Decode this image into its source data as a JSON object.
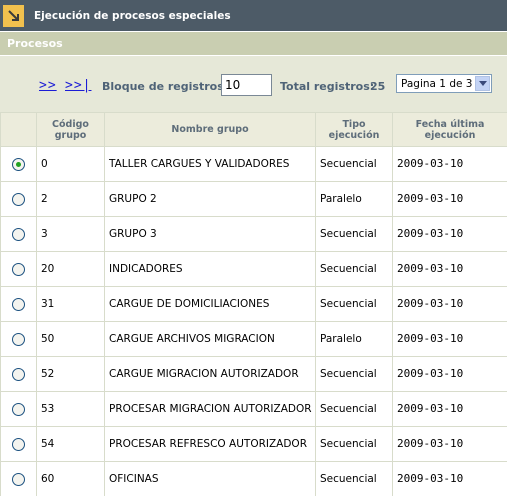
{
  "window": {
    "title": "Ejecución de procesos especiales",
    "icon": "arrow-down-right-icon"
  },
  "section": {
    "title": "Procesos"
  },
  "toolbar": {
    "nav_next": ">>",
    "nav_last": ">>|",
    "bloque_label": "Bloque de registros:",
    "bloque_value": "10",
    "total_label": "Total registros:",
    "total_value": "25",
    "page_select_value": "Pagina 1 de 3"
  },
  "table": {
    "headers": {
      "codigo": "Código grupo",
      "nombre": "Nombre grupo",
      "tipo": "Tipo ejecución",
      "fecha": "Fecha última ejecución"
    },
    "rows": [
      {
        "selected": true,
        "codigo": "0",
        "nombre": "TALLER CARGUES Y VALIDADORES",
        "tipo": "Secuencial",
        "fecha": "2009-03-10"
      },
      {
        "selected": false,
        "codigo": "2",
        "nombre": "GRUPO 2",
        "tipo": "Paralelo",
        "fecha": "2009-03-10"
      },
      {
        "selected": false,
        "codigo": "3",
        "nombre": "GRUPO 3",
        "tipo": "Secuencial",
        "fecha": "2009-03-10"
      },
      {
        "selected": false,
        "codigo": "20",
        "nombre": "INDICADORES",
        "tipo": "Secuencial",
        "fecha": "2009-03-10"
      },
      {
        "selected": false,
        "codigo": "31",
        "nombre": "CARGUE DE DOMICILIACIONES",
        "tipo": "Secuencial",
        "fecha": "2009-03-10"
      },
      {
        "selected": false,
        "codigo": "50",
        "nombre": "CARGUE ARCHIVOS MIGRACION",
        "tipo": "Paralelo",
        "fecha": "2009-03-10"
      },
      {
        "selected": false,
        "codigo": "52",
        "nombre": "CARGUE MIGRACION AUTORIZADOR",
        "tipo": "Secuencial",
        "fecha": "2009-03-10"
      },
      {
        "selected": false,
        "codigo": "53",
        "nombre": "PROCESAR MIGRACION AUTORIZADOR",
        "tipo": "Secuencial",
        "fecha": "2009-03-10"
      },
      {
        "selected": false,
        "codigo": "54",
        "nombre": "PROCESAR REFRESCO AUTORIZADOR",
        "tipo": "Secuencial",
        "fecha": "2009-03-10"
      },
      {
        "selected": false,
        "codigo": "60",
        "nombre": "OFICINAS",
        "tipo": "Secuencial",
        "fecha": "2009-03-10"
      }
    ]
  },
  "colors": {
    "titlebar": "#4d5b67",
    "section": "#c9ceb1",
    "toolbar": "#e6e8d8",
    "link": "#1c1cd6",
    "radio_dot": "#21a121"
  }
}
